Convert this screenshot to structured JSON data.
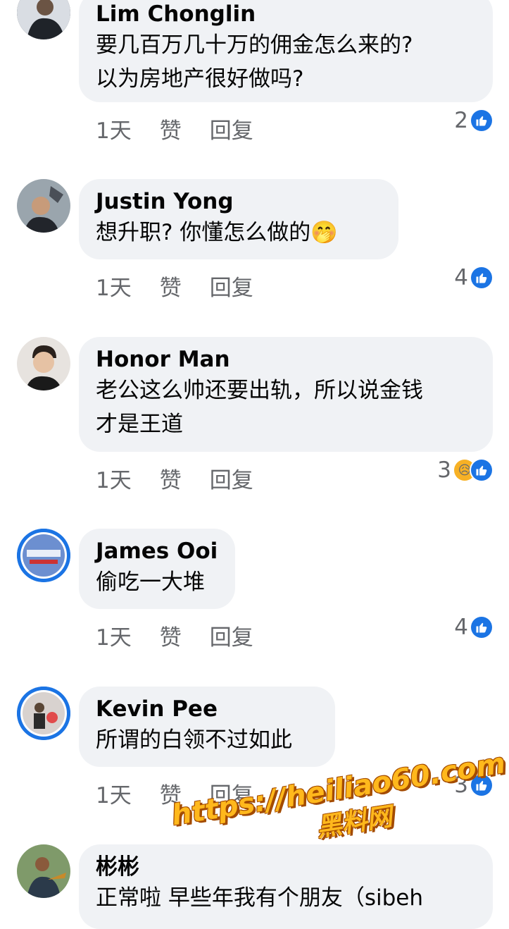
{
  "comments": [
    {
      "name": "Lim Chonglin",
      "text": "要几百万几十万的佣金怎么来的?\n以为房地产很好做吗?",
      "time": "1天",
      "like_label": "赞",
      "reply_label": "回复",
      "reaction_count": "2",
      "avatar": "man-in-suit-avatar"
    },
    {
      "name": "Justin Yong",
      "text": "想升职? 你懂怎么做的🤭",
      "time": "1天",
      "like_label": "赞",
      "reply_label": "回复",
      "reaction_count": "4",
      "avatar": "man-with-bird-avatar"
    },
    {
      "name": "Honor Man",
      "text": "老公这么帅还要出轨，所以说金钱\n才是王道",
      "time": "1天",
      "like_label": "赞",
      "reply_label": "回复",
      "reaction_count": "3",
      "avatar": "young-man-avatar"
    },
    {
      "name": "James Ooi",
      "text": "偷吃一大堆",
      "time": "1天",
      "like_label": "赞",
      "reply_label": "回复",
      "reaction_count": "4",
      "avatar": "logo-avatar"
    },
    {
      "name": "Kevin Pee",
      "text": "所谓的白领不过如此",
      "time": "1天",
      "like_label": "赞",
      "reply_label": "回复",
      "reaction_count": "3",
      "avatar": "man-photo-avatar"
    },
    {
      "name": "彬彬",
      "text": "正常啦 早些年我有个朋友（sibeh",
      "avatar": "fisherman-avatar"
    }
  ],
  "watermark": {
    "url": "https://heiliao60.com",
    "label": "黑料网"
  },
  "colors": {
    "accent": "#1b74e4",
    "bubble": "#f0f2f5",
    "meta": "#65676b"
  }
}
